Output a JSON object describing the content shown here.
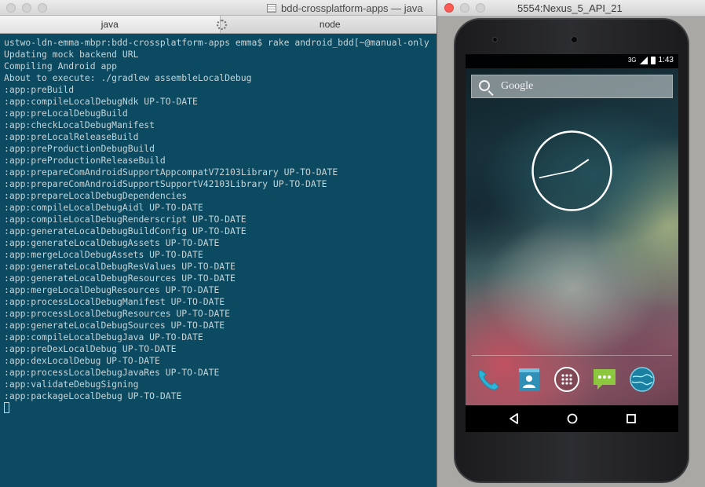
{
  "terminal": {
    "title": "bdd-crossplatform-apps — java",
    "tabs": [
      {
        "label": "java",
        "active": true
      },
      {
        "label": "node",
        "active": false
      }
    ],
    "lines": [
      "ustwo-ldn-emma-mbpr:bdd-crossplatform-apps emma$ rake android_bdd[~@manual-only",
      "Updating mock backend URL",
      "Compiling Android app",
      "About to execute: ./gradlew assembleLocalDebug",
      ":app:preBuild",
      ":app:compileLocalDebugNdk UP-TO-DATE",
      ":app:preLocalDebugBuild",
      ":app:checkLocalDebugManifest",
      ":app:preLocalReleaseBuild",
      ":app:preProductionDebugBuild",
      ":app:preProductionReleaseBuild",
      ":app:prepareComAndroidSupportAppcompatV72103Library UP-TO-DATE",
      ":app:prepareComAndroidSupportSupportV42103Library UP-TO-DATE",
      ":app:prepareLocalDebugDependencies",
      ":app:compileLocalDebugAidl UP-TO-DATE",
      ":app:compileLocalDebugRenderscript UP-TO-DATE",
      ":app:generateLocalDebugBuildConfig UP-TO-DATE",
      ":app:generateLocalDebugAssets UP-TO-DATE",
      ":app:mergeLocalDebugAssets UP-TO-DATE",
      ":app:generateLocalDebugResValues UP-TO-DATE",
      ":app:generateLocalDebugResources UP-TO-DATE",
      ":app:mergeLocalDebugResources UP-TO-DATE",
      ":app:processLocalDebugManifest UP-TO-DATE",
      ":app:processLocalDebugResources UP-TO-DATE",
      ":app:generateLocalDebugSources UP-TO-DATE",
      ":app:compileLocalDebugJava UP-TO-DATE",
      ":app:preDexLocalDebug UP-TO-DATE",
      ":app:dexLocalDebug UP-TO-DATE",
      ":app:processLocalDebugJavaRes UP-TO-DATE",
      ":app:validateDebugSigning",
      ":app:packageLocalDebug UP-TO-DATE"
    ],
    "colors": {
      "background": "#0b4a60",
      "text": "#c7d4d8"
    }
  },
  "emulator": {
    "title": "5554:Nexus_5_API_21",
    "status_time": "1:43",
    "status_signal": "3G",
    "search_label": "Google",
    "clock_hands": {
      "hour_angle_deg": 56,
      "minute_angle_deg": 258
    },
    "dock_icons": [
      "phone-icon",
      "contacts-icon",
      "app-drawer-icon",
      "messaging-icon",
      "browser-icon"
    ],
    "nav_icons": [
      "back-icon",
      "home-icon",
      "recents-icon"
    ]
  }
}
